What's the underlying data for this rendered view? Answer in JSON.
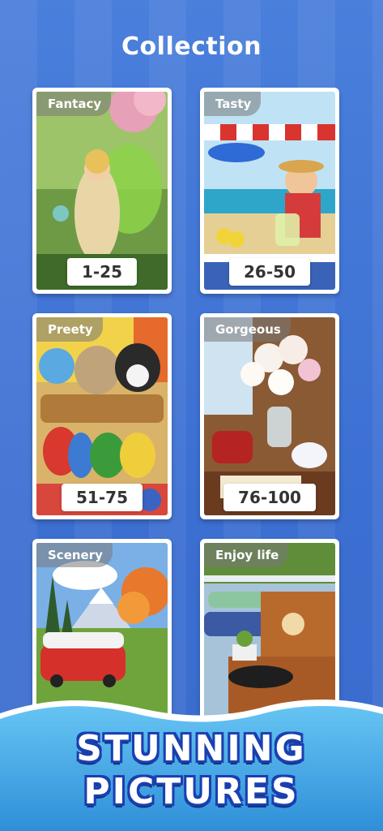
{
  "header": {
    "title": "Collection"
  },
  "cards": [
    {
      "tag": "Fantacy",
      "range": "1-25"
    },
    {
      "tag": "Tasty",
      "range": "26-50"
    },
    {
      "tag": "Preety",
      "range": "51-75"
    },
    {
      "tag": "Gorgeous",
      "range": "76-100"
    },
    {
      "tag": "Scenery",
      "range": ""
    },
    {
      "tag": "Enjoy life",
      "range": ""
    }
  ],
  "banner": {
    "line1": "STUNNING",
    "line2": "PICTURES"
  },
  "colors": {
    "background": "#3f74d6",
    "banner_outline": "#1a3fb0",
    "water": "#4fb4ef"
  }
}
